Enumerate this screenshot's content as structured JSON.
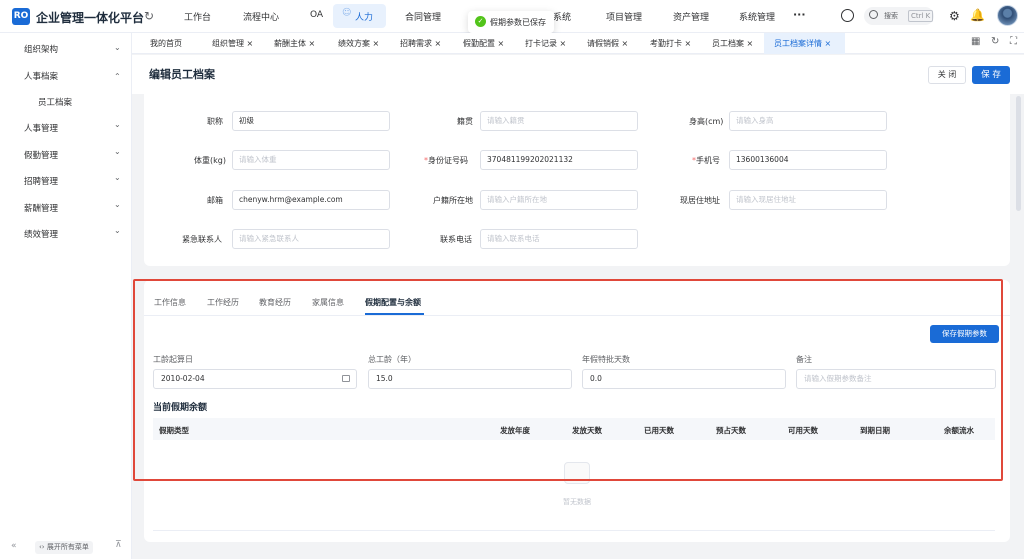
{
  "app": {
    "logo": "RO",
    "title": "企业管理一体化平台"
  },
  "nav": {
    "items": [
      "工作台",
      "流程中心",
      "OA",
      "人力",
      "合同管理",
      "系统",
      "项目管理",
      "资产管理",
      "系统管理"
    ],
    "active": "人力",
    "more": "···",
    "search_label": "搜索",
    "search_shortcut": "Ctrl K"
  },
  "toast": {
    "text": "假期参数已保存",
    "status_color": "#52c41a"
  },
  "sidebar": {
    "items": [
      {
        "label": "组织架构",
        "expanded": false
      },
      {
        "label": "人事档案",
        "expanded": true,
        "children": [
          "员工档案"
        ]
      },
      {
        "label": "人事管理",
        "expanded": false
      },
      {
        "label": "假勤管理",
        "expanded": false
      },
      {
        "label": "招聘管理",
        "expanded": false
      },
      {
        "label": "薪酬管理",
        "expanded": false
      },
      {
        "label": "绩效管理",
        "expanded": false
      }
    ],
    "expand_all_label": "展开所有菜单"
  },
  "tabs": [
    "我的首页",
    "组织管理",
    "薪酬主体",
    "绩效方案",
    "招聘需求",
    "假勤配置",
    "打卡记录",
    "请假销假",
    "考勤打卡",
    "员工档案",
    "员工档案详情"
  ],
  "active_tab": "员工档案详情",
  "page": {
    "title": "编辑员工档案",
    "close_label": "关 闭",
    "save_label": "保 存"
  },
  "form": {
    "title_label": "职称",
    "title_value": "初级",
    "native_label": "籍贯",
    "native_placeholder": "请输入籍贯",
    "height_label": "身高(cm)",
    "height_placeholder": "请输入身高",
    "weight_label": "体重(kg)",
    "weight_placeholder": "请输入体重",
    "id_label": "身份证号码",
    "id_value": "370481199202021132",
    "phone_label": "手机号",
    "phone_value": "13600136004",
    "email_label": "邮箱",
    "email_value": "chenyw.hrm@example.com",
    "hukou_label": "户籍所在地",
    "hukou_placeholder": "请输入户籍所在地",
    "address_label": "现居住地址",
    "address_placeholder": "请输入现居住地址",
    "emergency_label": "紧急联系人",
    "emergency_placeholder": "请输入紧急联系人",
    "contact_phone_label": "联系电话",
    "contact_phone_placeholder": "请输入联系电话"
  },
  "sub_tabs": [
    "工作信息",
    "工作经历",
    "教育经历",
    "家属信息",
    "假期配置与余额"
  ],
  "active_sub_tab": "假期配置与余额",
  "leave": {
    "save_button": "保存假期参数",
    "start_date_label": "工龄起算日",
    "start_date_value": "2010-02-04",
    "seniority_label": "总工龄（年）",
    "seniority_value": "15.0",
    "annual_days_label": "年假特批天数",
    "annual_days_value": "0.0",
    "note_label": "备注",
    "note_placeholder": "请输入假期参数备注",
    "balance_title": "当前假期余额",
    "columns": [
      "假期类型",
      "发放年度",
      "发放天数",
      "已用天数",
      "预占天数",
      "可用天数",
      "到期日期",
      "余额流水"
    ],
    "empty_text": "暂无数据"
  },
  "colors": {
    "primary": "#1a6bd6",
    "highlight": "#e0483a",
    "required": "#f56c6c"
  }
}
